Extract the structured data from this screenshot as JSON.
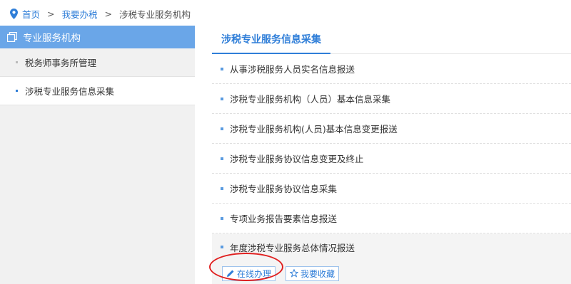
{
  "breadcrumb": {
    "home": "首页",
    "sep1": ">",
    "level1": "我要办税",
    "sep2": ">",
    "current": "涉税专业服务机构"
  },
  "sidebar": {
    "title": "专业服务机构",
    "items": [
      {
        "label": "税务师事务所管理"
      },
      {
        "label": "涉税专业服务信息采集"
      }
    ]
  },
  "main": {
    "tab": "涉税专业服务信息采集",
    "items": [
      {
        "label": "从事涉税服务人员实名信息报送"
      },
      {
        "label": "涉税专业服务机构（人员）基本信息采集"
      },
      {
        "label": "涉税专业服务机构(人员)基本信息变更报送"
      },
      {
        "label": "涉税专业服务协议信息变更及终止"
      },
      {
        "label": "涉税专业服务协议信息采集"
      },
      {
        "label": "专项业务报告要素信息报送"
      },
      {
        "label": "年度涉税专业服务总体情况报送"
      }
    ],
    "actions": {
      "online": "在线办理",
      "favorite": "我要收藏"
    }
  },
  "colors": {
    "accent": "#2f7ed8",
    "sidebar_header": "#6aa6e8",
    "annotation": "#e02020"
  },
  "icons": [
    "location-pin-icon",
    "window-icon",
    "pencil-icon",
    "star-icon"
  ]
}
